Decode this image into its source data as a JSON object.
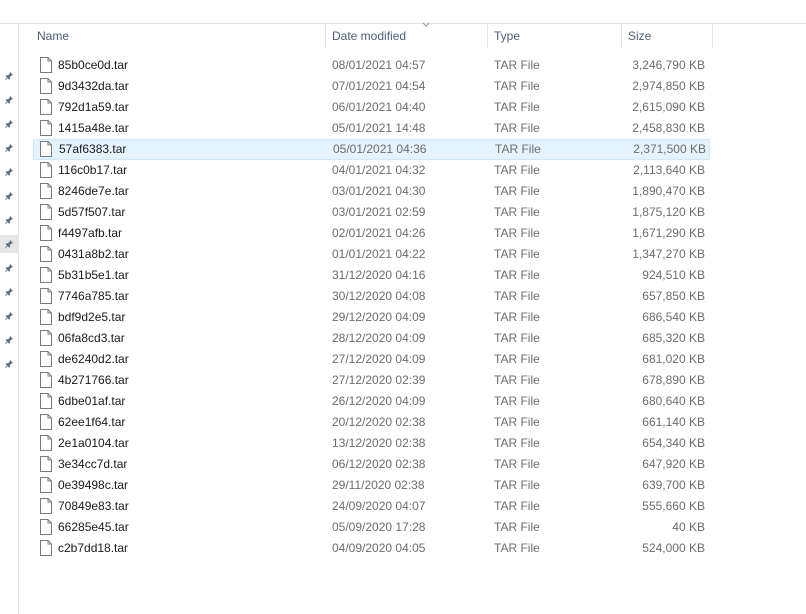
{
  "columns": {
    "name": "Name",
    "date_modified": "Date modified",
    "type": "Type",
    "size": "Size"
  },
  "files": [
    {
      "name": "85b0ce0d.tar",
      "date": "08/01/2021 04:57",
      "type": "TAR File",
      "size": "3,246,790 KB"
    },
    {
      "name": "9d3432da.tar",
      "date": "07/01/2021 04:54",
      "type": "TAR File",
      "size": "2,974,850 KB"
    },
    {
      "name": "792d1a59.tar",
      "date": "06/01/2021 04:40",
      "type": "TAR File",
      "size": "2,615,090 KB"
    },
    {
      "name": "1415a48e.tar",
      "date": "05/01/2021 14:48",
      "type": "TAR File",
      "size": "2,458,830 KB"
    },
    {
      "name": "57af6383.tar",
      "date": "05/01/2021 04:36",
      "type": "TAR File",
      "size": "2,371,500 KB",
      "selected": true
    },
    {
      "name": "116c0b17.tar",
      "date": "04/01/2021 04:32",
      "type": "TAR File",
      "size": "2,113,640 KB"
    },
    {
      "name": "8246de7e.tar",
      "date": "03/01/2021 04:30",
      "type": "TAR File",
      "size": "1,890,470 KB"
    },
    {
      "name": "5d57f507.tar",
      "date": "03/01/2021 02:59",
      "type": "TAR File",
      "size": "1,875,120 KB"
    },
    {
      "name": "f4497afb.tar",
      "date": "02/01/2021 04:26",
      "type": "TAR File",
      "size": "1,671,290 KB"
    },
    {
      "name": "0431a8b2.tar",
      "date": "01/01/2021 04:22",
      "type": "TAR File",
      "size": "1,347,270 KB"
    },
    {
      "name": "5b31b5e1.tar",
      "date": "31/12/2020 04:16",
      "type": "TAR File",
      "size": "924,510 KB"
    },
    {
      "name": "7746a785.tar",
      "date": "30/12/2020 04:08",
      "type": "TAR File",
      "size": "657,850 KB"
    },
    {
      "name": "bdf9d2e5.tar",
      "date": "29/12/2020 04:09",
      "type": "TAR File",
      "size": "686,540 KB"
    },
    {
      "name": "06fa8cd3.tar",
      "date": "28/12/2020 04:09",
      "type": "TAR File",
      "size": "685,320 KB"
    },
    {
      "name": "de6240d2.tar",
      "date": "27/12/2020 04:09",
      "type": "TAR File",
      "size": "681,020 KB"
    },
    {
      "name": "4b271766.tar",
      "date": "27/12/2020 02:39",
      "type": "TAR File",
      "size": "678,890 KB"
    },
    {
      "name": "6dbe01af.tar",
      "date": "26/12/2020 04:09",
      "type": "TAR File",
      "size": "680,640 KB"
    },
    {
      "name": "62ee1f64.tar",
      "date": "20/12/2020 02:38",
      "type": "TAR File",
      "size": "661,140 KB"
    },
    {
      "name": "2e1a0104.tar",
      "date": "13/12/2020 02:38",
      "type": "TAR File",
      "size": "654,340 KB"
    },
    {
      "name": "3e34cc7d.tar",
      "date": "06/12/2020 02:38",
      "type": "TAR File",
      "size": "647,920 KB"
    },
    {
      "name": "0e39498c.tar",
      "date": "29/11/2020 02:38",
      "type": "TAR File",
      "size": "639,700 KB"
    },
    {
      "name": "70849e83.tar",
      "date": "24/09/2020 04:07",
      "type": "TAR File",
      "size": "555,660 KB"
    },
    {
      "name": "66285e45.tar",
      "date": "05/09/2020 17:28",
      "type": "TAR File",
      "size": "40 KB"
    },
    {
      "name": "c2b7dd18.tar",
      "date": "04/09/2020 04:05",
      "type": "TAR File",
      "size": "524,000 KB"
    }
  ],
  "quick_access": {
    "pin_icon": "pin-icon",
    "pin_count": 13,
    "active_index": 7
  },
  "colors": {
    "header_text": "#4c607a",
    "selected_bg": "#e5f3ff",
    "selected_border": "#cce8ff",
    "pin_color": "#5c6f86"
  }
}
